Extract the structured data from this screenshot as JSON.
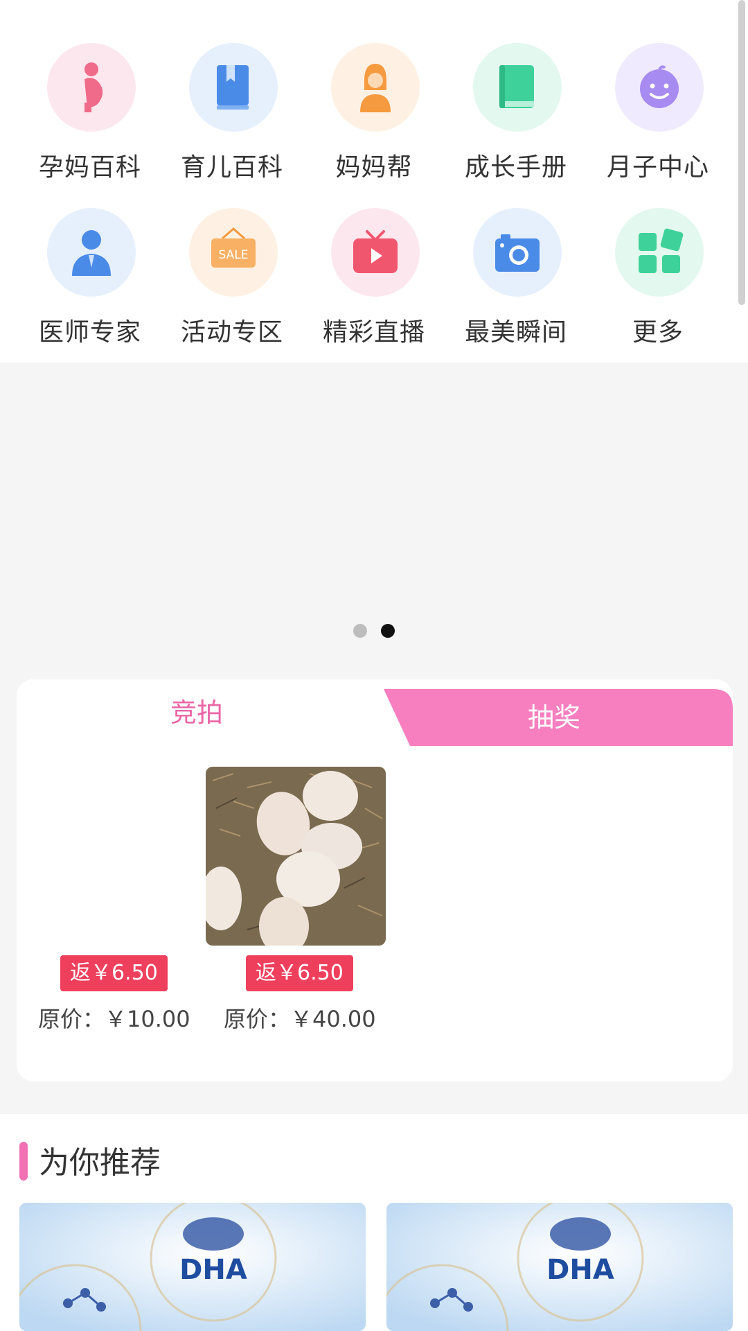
{
  "grid": {
    "items": [
      {
        "label": "孕妈百科",
        "icon": "pregnant-woman-icon",
        "color": "#f06a8a",
        "bg": "#fde7ee"
      },
      {
        "label": "育儿百科",
        "icon": "book-bookmark-icon",
        "color": "#4a8be8",
        "bg": "#e6f0fd"
      },
      {
        "label": "妈妈帮",
        "icon": "mother-icon",
        "color": "#f59a3f",
        "bg": "#fef1e3"
      },
      {
        "label": "成长手册",
        "icon": "handbook-icon",
        "color": "#3fd19a",
        "bg": "#e3f8ef"
      },
      {
        "label": "月子中心",
        "icon": "baby-face-icon",
        "color": "#a78bf0",
        "bg": "#efeafd"
      },
      {
        "label": "医师专家",
        "icon": "doctor-icon",
        "color": "#4a8be8",
        "bg": "#e6f0fd"
      },
      {
        "label": "活动专区",
        "icon": "sale-sign-icon",
        "color": "#f59a3f",
        "bg": "#fef1e3"
      },
      {
        "label": "精彩直播",
        "icon": "live-tv-icon",
        "color": "#f0566e",
        "bg": "#fde7ee"
      },
      {
        "label": "最美瞬间",
        "icon": "camera-icon",
        "color": "#4a8be8",
        "bg": "#e6f0fd"
      },
      {
        "label": "更多",
        "icon": "more-grid-icon",
        "color": "#3fd19a",
        "bg": "#e3f8ef"
      }
    ]
  },
  "carousel": {
    "active_index": 1,
    "count": 2
  },
  "auction": {
    "tabs": [
      {
        "label": "竞拍",
        "active": true
      },
      {
        "label": "抽奖",
        "active": false
      }
    ],
    "products": [
      {
        "rebate": "返￥6.50",
        "original_price": "原价：￥10.00",
        "image": "none"
      },
      {
        "rebate": "返￥6.50",
        "original_price": "原价：￥40.00",
        "image": "eggs-photo"
      }
    ]
  },
  "recommend": {
    "title": "为你推荐",
    "cards": [
      {
        "image_text": "DHA"
      },
      {
        "image_text": "DHA"
      }
    ]
  },
  "colors": {
    "accent_pink": "#f77fc0",
    "tab_active_text": "#ea66a6",
    "badge_red": "#ee3f5c"
  }
}
